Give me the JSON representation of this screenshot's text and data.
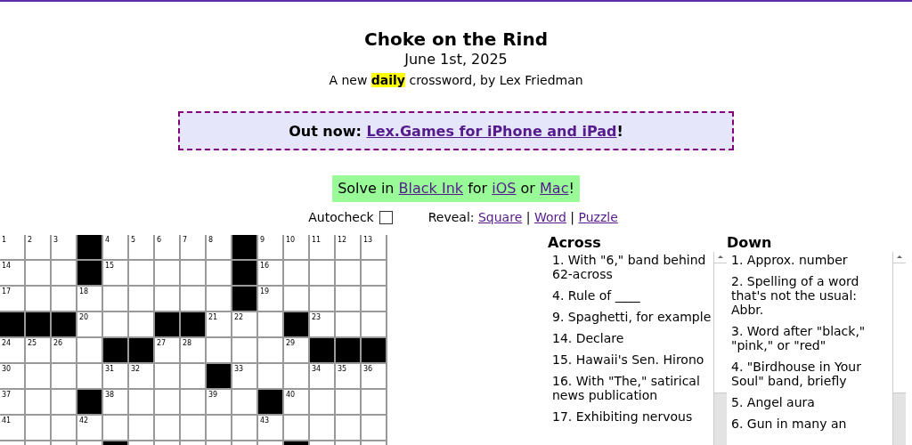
{
  "header": {
    "title": "Choke on the Rind",
    "date": "June 1st, 2025",
    "byline": "A new **daily** crossword, by Lex Friedman"
  },
  "promo": {
    "prefix": "Out now:",
    "link": "Lex.Games for iPhone and iPad",
    "suffix": "!"
  },
  "solve_in": [
    {
      "kind": "text",
      "text": "Solve in"
    },
    {
      "kind": "link",
      "text": "Black Ink"
    },
    {
      "kind": "text",
      "text": "for"
    },
    {
      "kind": "link",
      "text": "iOS"
    },
    {
      "kind": "text",
      "text": "or"
    },
    {
      "kind": "link",
      "text": "Mac"
    },
    {
      "kind": "end",
      "text": "!"
    }
  ],
  "autocheck": {
    "label": "Autocheck",
    "checked": false
  },
  "reveal": {
    "label": "Reveal:",
    "separator": "|",
    "options": [
      "Square",
      "Word",
      "Puzzle"
    ]
  },
  "grid": [
    [
      {
        "black": false,
        "number": "1"
      },
      {
        "black": false,
        "number": "2"
      },
      {
        "black": false,
        "number": "3"
      },
      {
        "black": true
      },
      {
        "black": false,
        "number": "4"
      },
      {
        "black": false,
        "number": "5"
      },
      {
        "black": false,
        "number": "6"
      },
      {
        "black": false,
        "number": "7"
      },
      {
        "black": false,
        "number": "8"
      },
      {
        "black": true
      },
      {
        "black": false,
        "number": "9"
      },
      {
        "black": false,
        "number": "10"
      },
      {
        "black": false,
        "number": "11"
      },
      {
        "black": false,
        "number": "12"
      },
      {
        "black": false,
        "number": "13"
      }
    ],
    [
      {
        "black": false,
        "number": "14"
      },
      {
        "black": false
      },
      {
        "black": false
      },
      {
        "black": true
      },
      {
        "black": false,
        "number": "15"
      },
      {
        "black": false
      },
      {
        "black": false
      },
      {
        "black": false
      },
      {
        "black": false
      },
      {
        "black": true
      },
      {
        "black": false,
        "number": "16"
      },
      {
        "black": false
      },
      {
        "black": false
      },
      {
        "black": false
      },
      {
        "black": false
      }
    ],
    [
      {
        "black": false,
        "number": "17"
      },
      {
        "black": false
      },
      {
        "black": false
      },
      {
        "black": false,
        "number": "18"
      },
      {
        "black": false
      },
      {
        "black": false
      },
      {
        "black": false
      },
      {
        "black": false
      },
      {
        "black": false
      },
      {
        "black": true
      },
      {
        "black": false,
        "number": "19"
      },
      {
        "black": false
      },
      {
        "black": false
      },
      {
        "black": false
      },
      {
        "black": false
      }
    ],
    [
      {
        "black": true
      },
      {
        "black": true
      },
      {
        "black": true
      },
      {
        "black": false,
        "number": "20"
      },
      {
        "black": false
      },
      {
        "black": false
      },
      {
        "black": true
      },
      {
        "black": true
      },
      {
        "black": false,
        "number": "21"
      },
      {
        "black": false,
        "number": "22"
      },
      {
        "black": false
      },
      {
        "black": true
      },
      {
        "black": false,
        "number": "23"
      },
      {
        "black": false
      },
      {
        "black": false
      }
    ],
    [
      {
        "black": false,
        "number": "24"
      },
      {
        "black": false,
        "number": "25"
      },
      {
        "black": false,
        "number": "26"
      },
      {
        "black": false
      },
      {
        "black": true
      },
      {
        "black": true
      },
      {
        "black": false,
        "number": "27"
      },
      {
        "black": false,
        "number": "28"
      },
      {
        "black": false
      },
      {
        "black": false
      },
      {
        "black": false
      },
      {
        "black": false,
        "number": "29"
      },
      {
        "black": true
      },
      {
        "black": true
      },
      {
        "black": true
      }
    ],
    [
      {
        "black": false,
        "number": "30"
      },
      {
        "black": false
      },
      {
        "black": false
      },
      {
        "black": false
      },
      {
        "black": false,
        "number": "31"
      },
      {
        "black": false,
        "number": "32"
      },
      {
        "black": false
      },
      {
        "black": false
      },
      {
        "black": true
      },
      {
        "black": false,
        "number": "33"
      },
      {
        "black": false
      },
      {
        "black": false
      },
      {
        "black": false,
        "number": "34"
      },
      {
        "black": false,
        "number": "35"
      },
      {
        "black": false,
        "number": "36"
      }
    ],
    [
      {
        "black": false,
        "number": "37"
      },
      {
        "black": false
      },
      {
        "black": false
      },
      {
        "black": true
      },
      {
        "black": false,
        "number": "38"
      },
      {
        "black": false
      },
      {
        "black": false
      },
      {
        "black": false
      },
      {
        "black": false,
        "number": "39"
      },
      {
        "black": false
      },
      {
        "black": true
      },
      {
        "black": false,
        "number": "40"
      },
      {
        "black": false
      },
      {
        "black": false
      },
      {
        "black": false
      }
    ],
    [
      {
        "black": false,
        "number": "41"
      },
      {
        "black": false
      },
      {
        "black": false
      },
      {
        "black": false,
        "number": "42"
      },
      {
        "black": false
      },
      {
        "black": false
      },
      {
        "black": false
      },
      {
        "black": false
      },
      {
        "black": false
      },
      {
        "black": false
      },
      {
        "black": false,
        "number": "43"
      },
      {
        "black": false
      },
      {
        "black": false
      },
      {
        "black": false
      },
      {
        "black": false
      }
    ],
    [
      {
        "black": false
      },
      {
        "black": false
      },
      {
        "black": false
      },
      {
        "black": false
      },
      {
        "black": true
      },
      {
        "black": false
      },
      {
        "black": false
      },
      {
        "black": false
      },
      {
        "black": false
      },
      {
        "black": false
      },
      {
        "black": false
      },
      {
        "black": true
      },
      {
        "black": false
      },
      {
        "black": false
      },
      {
        "black": false
      }
    ]
  ],
  "clues": [
    {
      "heading": "Across",
      "items": [
        "1. With \"6,\" band behind 62-across",
        "4. Rule of ____",
        "9. Spaghetti, for example",
        "14. Declare",
        "15. Hawaii's Sen. Hirono",
        "16. With \"The,\" satirical news publication",
        "17. Exhibiting nervous"
      ]
    },
    {
      "heading": "Down",
      "items": [
        "1. Approx. number",
        "2. Spelling of a word that's not the usual: Abbr.",
        "3. Word after \"black,\" \"pink,\" or \"red\"",
        "4. \"Birdhouse in Your Soul\" band, briefly",
        "5. Angel aura",
        "6. Gun in many an"
      ]
    }
  ]
}
